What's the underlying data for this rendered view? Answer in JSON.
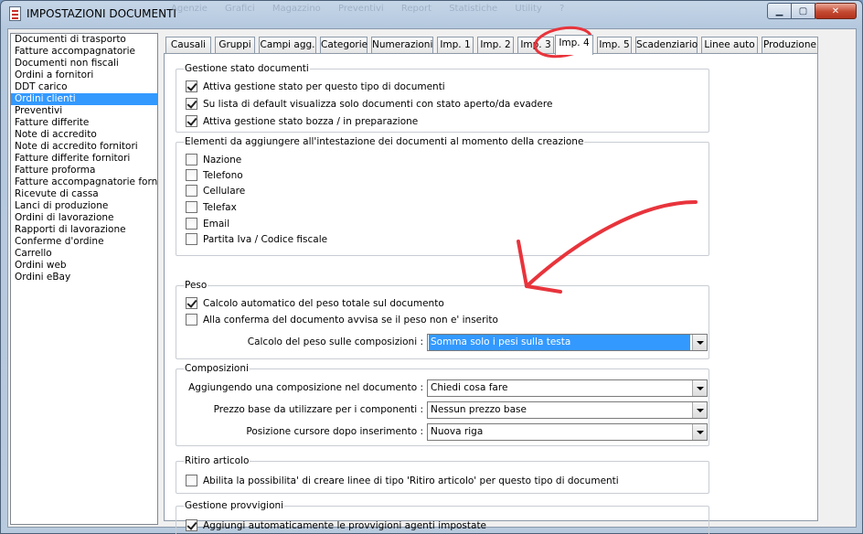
{
  "window": {
    "title": "IMPOSTAZIONI DOCUMENTI",
    "background_menu": [
      "Agenzie",
      "Grafici",
      "Magazzino",
      "Preventivi",
      "Report",
      "Statistiche",
      "Utility",
      "?"
    ],
    "minimize_glyph": "▁",
    "maximize_glyph": "▢",
    "close_glyph": "✕"
  },
  "doc_list": {
    "items": [
      "Documenti di trasporto",
      "Fatture accompagnatorie",
      "Documenti non fiscali",
      "Ordini a fornitori",
      "DDT carico",
      "Ordini clienti",
      "Preventivi",
      "Fatture differite",
      "Note di accredito",
      "Note di accredito fornitori",
      "Fatture differite fornitori",
      "Fatture proforma",
      "Fatture accompagnatorie fornitori",
      "Ricevute di cassa",
      "Lanci di produzione",
      "Ordini di lavorazione",
      "Rapporti di lavorazione",
      "Conferme d'ordine",
      "Carrello",
      "Ordini web",
      "Ordini eBay"
    ],
    "selected": "Ordini clienti"
  },
  "tabs": [
    "Causali",
    "Gruppi",
    "Campi agg.",
    "Categorie",
    "Numerazioni",
    "Imp. 1",
    "Imp. 2",
    "Imp. 3",
    "Imp. 4",
    "Imp. 5",
    "Scadenziario",
    "Linee auto",
    "Produzione"
  ],
  "active_tab": "Imp. 4",
  "gestione_stato": {
    "title": "Gestione stato documenti",
    "options": [
      {
        "label": "Attiva gestione stato per questo tipo di documenti",
        "checked": true
      },
      {
        "label": "Su lista di default visualizza solo documenti con stato aperto/da evadere",
        "checked": true
      },
      {
        "label": "Attiva gestione stato bozza / in preparazione",
        "checked": true
      }
    ]
  },
  "intestazione": {
    "title": "Elementi da aggiungere all'intestazione dei documenti al momento della creazione",
    "options": [
      {
        "label": "Nazione",
        "checked": false
      },
      {
        "label": "Telefono",
        "checked": false
      },
      {
        "label": "Cellulare",
        "checked": false
      },
      {
        "label": "Telefax",
        "checked": false
      },
      {
        "label": "Email",
        "checked": false
      },
      {
        "label": "Partita Iva / Codice fiscale",
        "checked": false
      }
    ]
  },
  "peso": {
    "title": "Peso",
    "options": [
      {
        "label": "Calcolo automatico del peso totale sul documento",
        "checked": true
      },
      {
        "label": "Alla conferma del documento avvisa se il peso non e' inserito",
        "checked": false
      }
    ],
    "calcolo_label": "Calcolo del peso sulle composizioni :",
    "calcolo_value": "Somma solo i pesi sulla testa"
  },
  "composizioni": {
    "title": "Composizioni",
    "fields": [
      {
        "label": "Aggiungendo una composizione nel documento :",
        "value": "Chiedi cosa fare"
      },
      {
        "label": "Prezzo base da utilizzare per i componenti :",
        "value": "Nessun prezzo base"
      },
      {
        "label": "Posizione cursore dopo inserimento :",
        "value": "Nuova riga"
      }
    ]
  },
  "ritiro": {
    "title": "Ritiro articolo",
    "option": {
      "label": "Abilita la possibilita' di creare linee di tipo 'Ritiro articolo' per questo tipo di documenti",
      "checked": false
    }
  },
  "provvigioni": {
    "title": "Gestione provvigioni",
    "option": {
      "label": "Aggiungi automaticamente le provvigioni agenti impostate",
      "checked": true
    }
  },
  "annotation_color": "#e8343c"
}
